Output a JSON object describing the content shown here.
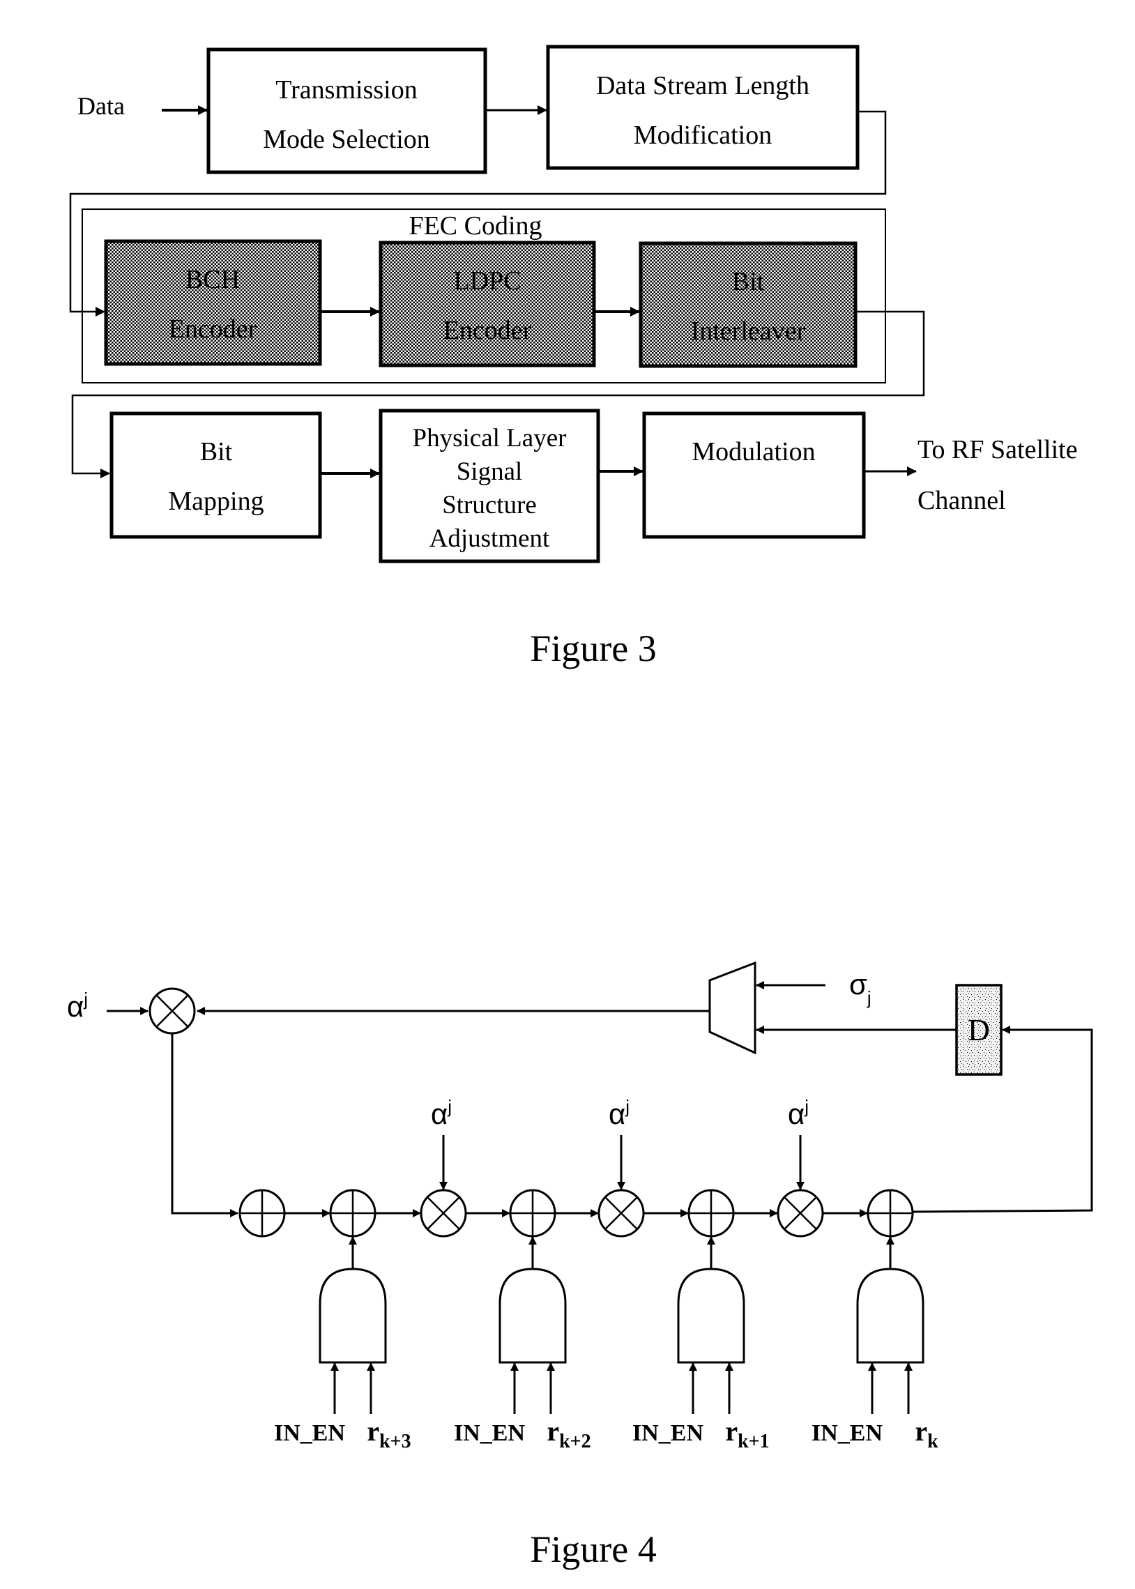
{
  "figure3": {
    "caption": "Figure 3",
    "input_label": "Data",
    "output_label_line1": "To RF Satellite",
    "output_label_line2": "Channel",
    "group_label": "FEC Coding",
    "blocks": {
      "transmission_mode": [
        "Transmission",
        "Mode Selection"
      ],
      "stream_length": [
        "Data Stream Length",
        "Modification"
      ],
      "bch": [
        "BCH",
        "Encoder"
      ],
      "ldpc": [
        "LDPC",
        "Encoder"
      ],
      "interleaver": [
        "Bit",
        "Interleaver"
      ],
      "bit_mapping": [
        "Bit",
        "Mapping"
      ],
      "physical_layer": [
        "Physical Layer",
        "Signal",
        "Structure",
        "Adjustment"
      ],
      "modulation": [
        "Modulation"
      ]
    },
    "shaded_fill": "#c8c8c8"
  },
  "figure4": {
    "caption": "Figure 4",
    "alpha_base": "α",
    "alpha_exp": "j",
    "sigma_base": "σ",
    "sigma_sub": "j",
    "delay_label": "D",
    "enable_label": "IN_EN",
    "r_base": "r",
    "r_subscripts": [
      "k+3",
      "k+2",
      "k+1",
      "k"
    ]
  }
}
